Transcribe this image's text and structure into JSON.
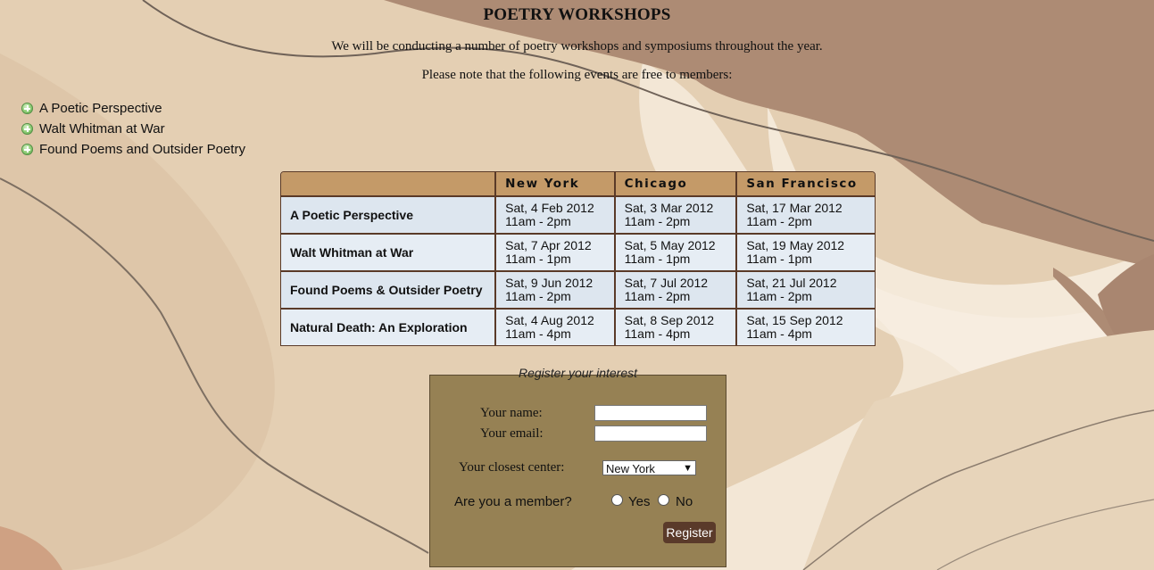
{
  "page": {
    "title": "POETRY WORKSHOPS",
    "intro_1": "We will be conducting a number of poetry workshops and symposiums throughout the year.",
    "intro_2": "Please note that the following events are free to members:"
  },
  "events": [
    "A Poetic Perspective",
    "Walt Whitman at War",
    "Found Poems and Outsider Poetry"
  ],
  "schedule": {
    "headers": [
      "",
      "New York",
      "Chicago",
      "San Francisco"
    ],
    "rows": [
      {
        "name": "A Poetic Perspective",
        "cells": [
          {
            "date": "Sat, 4 Feb 2012",
            "time": "11am - 2pm"
          },
          {
            "date": "Sat, 3 Mar 2012",
            "time": "11am - 2pm"
          },
          {
            "date": "Sat, 17 Mar 2012",
            "time": "11am - 2pm"
          }
        ]
      },
      {
        "name": "Walt Whitman at War",
        "cells": [
          {
            "date": "Sat, 7 Apr 2012",
            "time": "11am - 1pm"
          },
          {
            "date": "Sat, 5 May 2012",
            "time": "11am - 1pm"
          },
          {
            "date": "Sat, 19 May 2012",
            "time": "11am - 1pm"
          }
        ]
      },
      {
        "name": "Found Poems & Outsider Poetry",
        "cells": [
          {
            "date": "Sat, 9 Jun 2012",
            "time": "11am - 2pm"
          },
          {
            "date": "Sat, 7 Jul 2012",
            "time": "11am - 2pm"
          },
          {
            "date": "Sat, 21 Jul 2012",
            "time": "11am - 2pm"
          }
        ]
      },
      {
        "name": "Natural Death: An Exploration",
        "cells": [
          {
            "date": "Sat, 4 Aug 2012",
            "time": "11am - 4pm"
          },
          {
            "date": "Sat, 8 Sep 2012",
            "time": "11am - 4pm"
          },
          {
            "date": "Sat, 15 Sep 2012",
            "time": "11am - 4pm"
          }
        ]
      }
    ]
  },
  "form": {
    "legend": "Register your interest",
    "name_label": "Your name:",
    "name_value": "",
    "email_label": "Your email:",
    "email_value": "",
    "center_label": "Your closest center:",
    "center_value": "New York",
    "member_label": "Are you a member?",
    "yes_label": "Yes",
    "no_label": "No",
    "submit_label": "Register"
  },
  "colors": {
    "table_header": "#c49a68",
    "form_bg": "#968154",
    "button": "#5a3a2a"
  }
}
